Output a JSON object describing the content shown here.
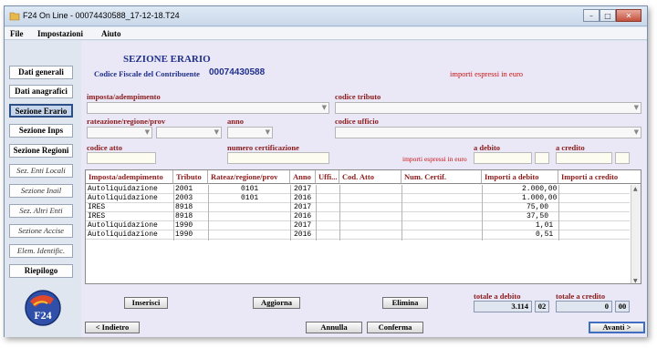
{
  "window": {
    "title": "F24 On Line - 00074430588_17-12-18.T24"
  },
  "menu": [
    "File",
    "Impostazioni",
    "Aiuto"
  ],
  "sidebar": {
    "items": [
      {
        "label": "Dati generali"
      },
      {
        "label": "Dati anagrafici"
      },
      {
        "label": "Sezione Erario"
      },
      {
        "label": "Sezione Inps"
      },
      {
        "label": "Sezione Regioni"
      },
      {
        "label": "Sez. Enti Locali"
      },
      {
        "label": "Sezione Inail"
      },
      {
        "label": "Sez. Altri Enti"
      },
      {
        "label": "Sezione Accise"
      },
      {
        "label": "Elem. Identific."
      },
      {
        "label": "Riepilogo"
      }
    ],
    "logo_text": "F24"
  },
  "section": {
    "title": "SEZIONE ERARIO",
    "cf_label": "Codice Fiscale del Contribuente",
    "cf_value": "00074430588",
    "note": "importi espressi in euro"
  },
  "form": {
    "imposta_label": "imposta/adempimento",
    "codice_tributo_label": "codice tributo",
    "rateazione_label": "rateazione/regione/prov",
    "anno_label": "anno",
    "codice_ufficio_label": "codice ufficio",
    "codice_atto_label": "codice atto",
    "numero_cert_label": "numero certificazione",
    "importi_note": "importi espressi in euro",
    "debito_label": "a debito",
    "credito_label": "a credito"
  },
  "table": {
    "headers": [
      "Imposta/adempimento",
      "Tributo",
      "Rateaz/regione/prov",
      "Anno",
      "Uffi...",
      "Cod. Atto",
      "Num. Certif.",
      "Importi a debito",
      "Importi a credito"
    ],
    "rows": [
      [
        "Autoliquidazione",
        "2001",
        "0101",
        "2017",
        "",
        "",
        "",
        "2.000,00",
        ""
      ],
      [
        "Autoliquidazione",
        "2003",
        "0101",
        "2016",
        "",
        "",
        "",
        "1.000,00",
        ""
      ],
      [
        "IRES",
        "8918",
        "",
        "2017",
        "",
        "",
        "",
        "75,00",
        ""
      ],
      [
        "IRES",
        "8918",
        "",
        "2016",
        "",
        "",
        "",
        "37,50",
        ""
      ],
      [
        "Autoliquidazione",
        "1990",
        "",
        "2017",
        "",
        "",
        "",
        "1,01",
        ""
      ],
      [
        "Autoliquidazione",
        "1990",
        "",
        "2016",
        "",
        "",
        "",
        "0,51",
        ""
      ]
    ]
  },
  "actions": {
    "inserisci": "Inserisci",
    "aggiorna": "Aggiorna",
    "elimina": "Elimina"
  },
  "totals": {
    "debito_label": "totale a debito",
    "debito_int": "3.114",
    "debito_dec": "02",
    "credito_label": "totale a credito",
    "credito_int": "0",
    "credito_dec": "00"
  },
  "footer": {
    "indietro": "< Indietro",
    "annulla": "Annulla",
    "conferma": "Conferma",
    "avanti": "Avanti >"
  }
}
